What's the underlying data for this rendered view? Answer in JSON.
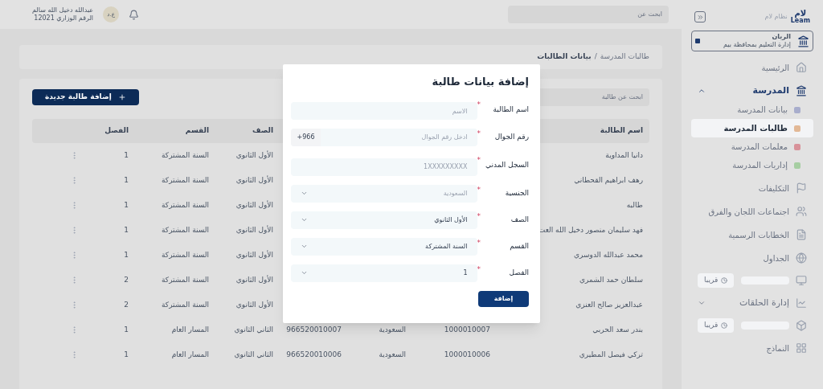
{
  "sidebar": {
    "logo_text": "لام",
    "logo_latin": "Leam",
    "system_name": "نظام لام",
    "school": {
      "name": "الريان",
      "office": "إدارة التعليم بمحافظة بيم"
    },
    "menu": [
      {
        "kind": "item",
        "label": "الرئيسية"
      },
      {
        "kind": "group",
        "label": "المدرسة",
        "expanded": true,
        "children": [
          {
            "label": "بيانات المدرسة",
            "color": "#a8adcc",
            "selected": false
          },
          {
            "label": "طالبات المدرسة",
            "color": "#e2b896",
            "selected": true
          },
          {
            "label": "معلمات المدرسة",
            "color": "#d8929a",
            "selected": false
          },
          {
            "label": "إداريات المدرسة",
            "color": "#a6cea2",
            "selected": false
          }
        ]
      },
      {
        "kind": "item",
        "label": "التكليفات"
      },
      {
        "kind": "item",
        "label": "اجتماعات اللجان والفرق"
      },
      {
        "kind": "item",
        "label": "الخطابات الرسمية"
      },
      {
        "kind": "item",
        "label": "الجداول"
      },
      {
        "kind": "soon",
        "badge": "قريبا"
      },
      {
        "kind": "group",
        "label": "إدارة الحلقات",
        "expanded": false
      },
      {
        "kind": "soon",
        "badge": "قريبا"
      },
      {
        "kind": "item",
        "label": "النماذج"
      }
    ]
  },
  "header": {
    "search": {
      "placeholder": "ابحث عن"
    },
    "user": {
      "name": "عبدالله دخيل الله سالم",
      "role": "الرقم الوزاري 12021",
      "initials": "ع.د"
    }
  },
  "breadcrumb_separator": "/",
  "breadcrumb": [
    {
      "label": "طالبات المدرسة",
      "current": false
    },
    {
      "label": "بيانات الطالبات",
      "current": true
    }
  ],
  "toolbar": {
    "search": {
      "placeholder": "ابحث عن طالبة"
    },
    "add_button": "إضافة طالبة جديدة"
  },
  "table": {
    "headers": {
      "name": "اسم الطالبة",
      "grade": "الصف",
      "section": "القسم",
      "class": "الفصل"
    },
    "rows": [
      {
        "name": "دانيا المداوية",
        "grade": "الأول الثانوي",
        "section": "السنة المشتركة",
        "class": "1"
      },
      {
        "name": "رهف ابراهيم القحطاني",
        "grade": "الأول الثانوي",
        "section": "السنة المشتركة",
        "class": "1"
      },
      {
        "name": "طالبه",
        "grade": "الأول الثانوي",
        "section": "السنة المشتركة",
        "class": "1"
      },
      {
        "name": "فهد سليمان منصور دخيل الله العت",
        "grade": "الأول الثانوي",
        "section": "السنة المشتركة",
        "class": "1"
      },
      {
        "name": "محمد عبدالله الدوسري",
        "grade": "الأول الثانوي",
        "section": "السنة المشتركة",
        "class": "1"
      },
      {
        "name": "سلطان حمد الشمري",
        "grade": "الأول الثانوي",
        "section": "السنة المشتركة",
        "class": "2"
      },
      {
        "name": "عبدالعزيز صالح العنزي",
        "grade": "الأول الثانوي",
        "section": "السنة المشتركة",
        "class": "2"
      },
      {
        "name": "بندر سعد الحربي",
        "column_2": "1000010007",
        "column_3": "السعودية",
        "column_4": "966520010007",
        "grade": "الثاني الثانوي",
        "section": "المسار العام",
        "class": "1"
      },
      {
        "name": "تركي فيصل المطيري",
        "column_2": "1000010006",
        "column_3": "السعودية",
        "column_4": "966520010006",
        "grade": "الثاني الثانوي",
        "section": "المسار العام",
        "class": "1"
      }
    ]
  },
  "modal": {
    "title": "إضافة بيانات طالبة",
    "submit": "إضافة",
    "required_mark": "*",
    "fields": [
      {
        "kind": "text",
        "label": "اسم الطالبة",
        "required": true,
        "placeholder": "الاسم"
      },
      {
        "kind": "phone",
        "label": "رقم الجوال",
        "required": true,
        "placeholder": "ادخل رقم الجوال",
        "prefix": "+966"
      },
      {
        "kind": "text",
        "label": "السجل المدني",
        "required": true,
        "placeholder": "1XXXXXXXXX"
      },
      {
        "kind": "select",
        "label": "الجنسية",
        "required": true,
        "placeholder": "السعودية"
      },
      {
        "kind": "select",
        "label": "الصف",
        "required": true,
        "value": "الأول الثانوي"
      },
      {
        "kind": "select",
        "label": "القسم",
        "required": true,
        "value": "السنة المشتركة"
      },
      {
        "kind": "select",
        "label": "الفصل",
        "required": true,
        "value": "1"
      }
    ]
  }
}
